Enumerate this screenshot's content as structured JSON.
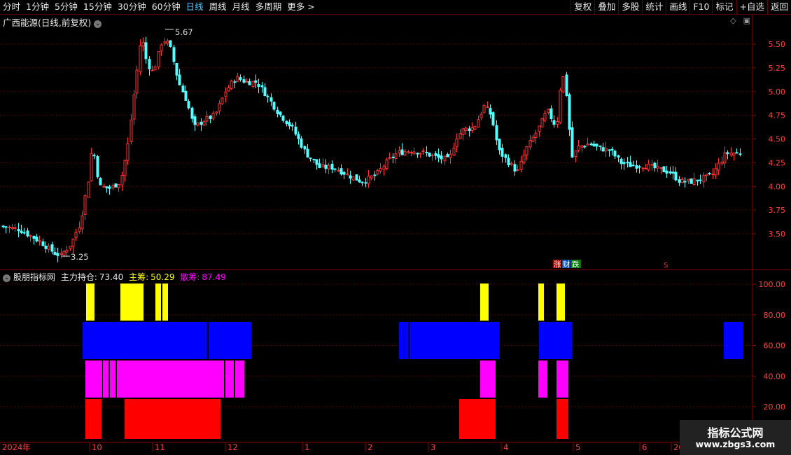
{
  "toolbar": {
    "periods": [
      "分时",
      "1分钟",
      "5分钟",
      "15分钟",
      "30分钟",
      "60分钟",
      "日线",
      "周线",
      "月线",
      "多周期",
      "更多 >"
    ],
    "active_period": "日线",
    "actions": [
      "复权",
      "叠加",
      "多股",
      "统计",
      "画线",
      "F10",
      "标记",
      "+自选",
      "返回"
    ]
  },
  "chart_title": "广西能源(日线,前复权)",
  "price_axis": [
    "5.50",
    "5.25",
    "5.00",
    "4.75",
    "4.50",
    "4.25",
    "4.00",
    "3.75",
    "3.50"
  ],
  "annotations": {
    "high": "5.67",
    "low": "3.25",
    "zhang": "涨",
    "cai": "财",
    "die": "跌",
    "s": "S"
  },
  "indicator": {
    "name": "股朋指标网",
    "main_pos_label": "主力持仓:",
    "main_pos_value": "73.40",
    "zhuchou_label": "主筹:",
    "zhuchou_value": "50.29",
    "sanchou_label": "散筹:",
    "sanchou_value": "87.49",
    "axis": [
      "100.00",
      "80.00",
      "60.00",
      "40.00",
      "20.00"
    ]
  },
  "time_axis": [
    "2024年",
    "10",
    "11",
    "12",
    "1",
    "2",
    "3",
    "4",
    "5",
    "6",
    "20"
  ],
  "logo": {
    "line1": "指标公式网",
    "line2": "www.zbgs3.com"
  },
  "colors": {
    "up": "#ff3232",
    "down": "#54ffff",
    "yellow": "#ffff00",
    "blue": "#0000ff",
    "magenta": "#ff00ff",
    "red": "#ff0000",
    "grid": "#5a0000"
  },
  "chart_data": {
    "type": "candlestick",
    "price_range": [
      3.25,
      5.67
    ],
    "indicator_bars": {
      "yellow": [
        [
          123,
          135
        ],
        [
          172,
          205
        ],
        [
          222,
          230
        ],
        [
          232,
          240
        ],
        [
          686,
          698
        ],
        [
          769,
          777
        ],
        [
          795,
          807
        ]
      ],
      "blue": [
        [
          118,
          295
        ],
        [
          298,
          359
        ],
        [
          570,
          583
        ],
        [
          585,
          713
        ],
        [
          770,
          817
        ],
        [
          1034,
          1061
        ]
      ],
      "magenta": [
        [
          122,
          146
        ],
        [
          147,
          155
        ],
        [
          157,
          165
        ],
        [
          167,
          320
        ],
        [
          322,
          334
        ],
        [
          336,
          349
        ],
        [
          686,
          708
        ],
        [
          769,
          782
        ],
        [
          795,
          812
        ]
      ],
      "red": [
        [
          122,
          145
        ],
        [
          178,
          315
        ],
        [
          656,
          708
        ],
        [
          795,
          812
        ]
      ]
    }
  }
}
